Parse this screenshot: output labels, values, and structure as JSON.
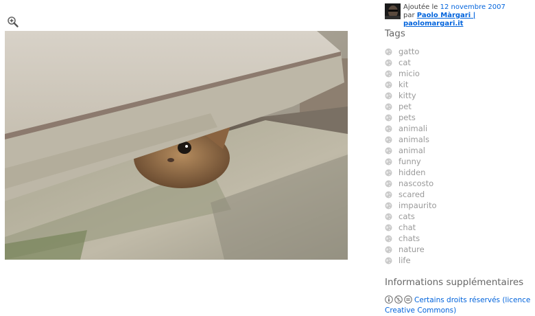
{
  "photo": {
    "alt": "Kitten peeking out from under a stone step"
  },
  "zoom": {
    "icon": "zoom-in-icon"
  },
  "uploaded": {
    "prefix": "Ajoutée le",
    "date": "12 novembre 2007",
    "by": "par",
    "author": "Paolo Màrgari | paolomargari.it"
  },
  "tags": {
    "title": "Tags",
    "items": [
      "gatto",
      "cat",
      "micio",
      "kit",
      "kitty",
      "pet",
      "pets",
      "animali",
      "animals",
      "animal",
      "funny",
      "hidden",
      "nascosto",
      "scared",
      "impaurito",
      "cats",
      "chat",
      "chats",
      "nature",
      "life"
    ]
  },
  "info": {
    "title": "Informations supplémentaires",
    "license_text": "Certains droits réservés (licence Creative Commons)"
  },
  "colors": {
    "link": "#0063dc",
    "tag": "#999999",
    "heading": "#666666"
  }
}
